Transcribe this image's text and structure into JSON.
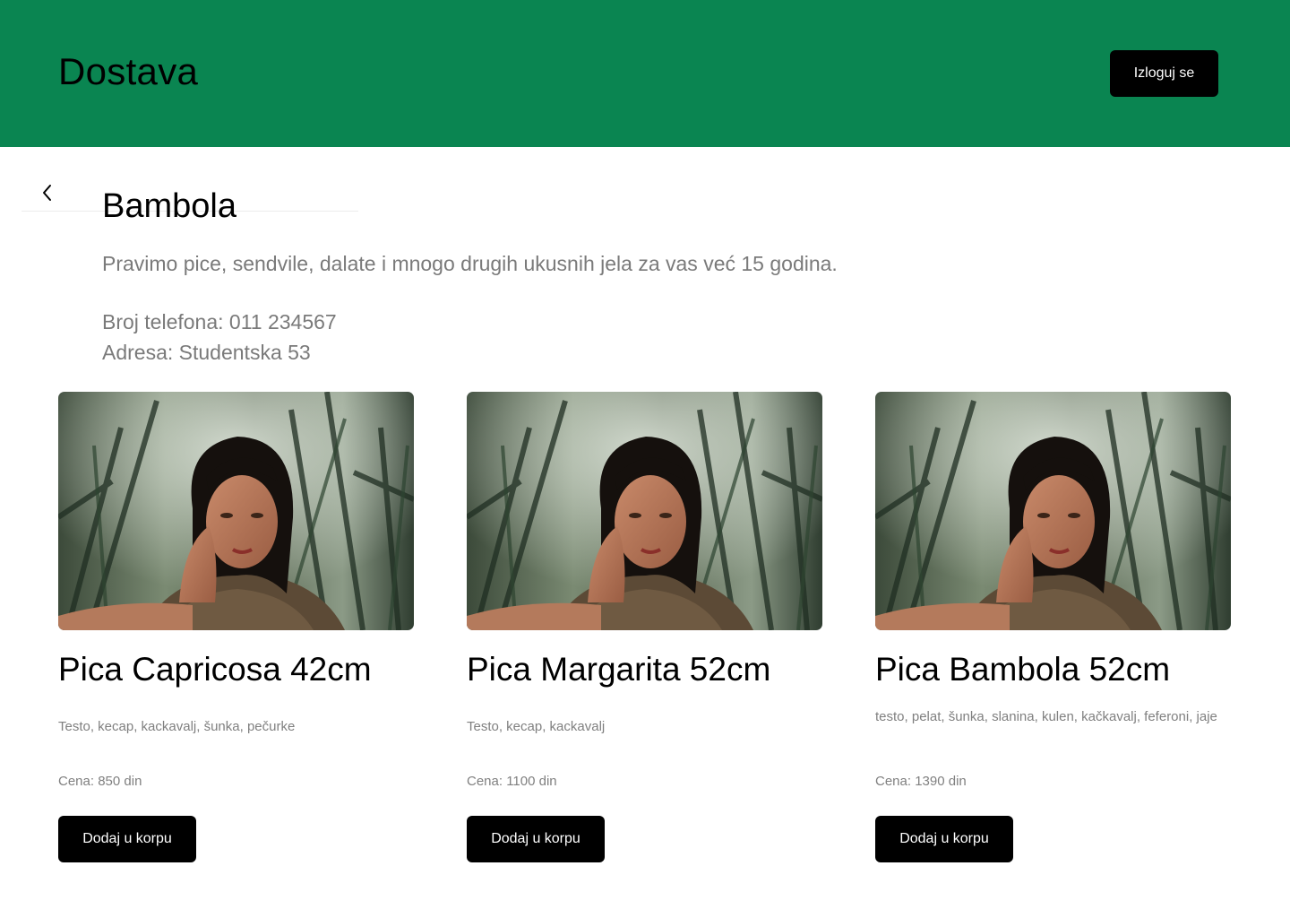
{
  "header": {
    "brand": "Dostava",
    "logout_label": "Izloguj se",
    "background_color": "#0a8551"
  },
  "restaurant": {
    "back_icon": "chevron-left-icon",
    "name": "Bambola",
    "description": "Pravimo pice, sendvile, dalate i mnogo drugih ukusnih jela za vas već 15 godina.",
    "phone": "Broj telefona: 011 234567",
    "address": "Adresa: Studentska 53"
  },
  "products": [
    {
      "name": "Pica Capricosa 42cm",
      "ingredients": "Testo, kecap, kackavalj, šunka, pečurke",
      "price": "Cena: 850 din",
      "button_label": "Dodaj u korpu"
    },
    {
      "name": "Pica Margarita 52cm",
      "ingredients": "Testo, kecap, kackavalj",
      "price": "Cena: 1100 din",
      "button_label": "Dodaj u korpu"
    },
    {
      "name": "Pica Bambola 52cm",
      "ingredients": "testo, pelat, šunka, slanina, kulen, kačkavalj, feferoni, jaje",
      "price": "Cena: 1390 din",
      "button_label": "Dodaj u korpu"
    }
  ]
}
